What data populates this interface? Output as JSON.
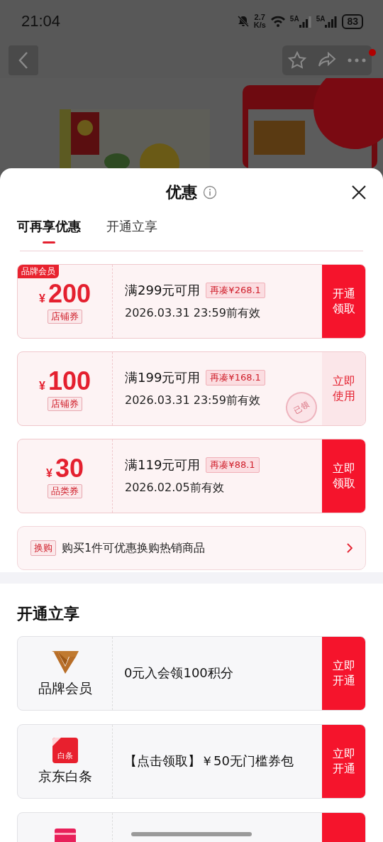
{
  "status_bar": {
    "time": "21:04",
    "net_speed": "2.7",
    "net_unit": "K/s",
    "sim1": "5A",
    "sim2": "5A",
    "battery": "83"
  },
  "sheet": {
    "title": "优惠",
    "tabs": [
      {
        "label": "可再享优惠",
        "selected": true
      },
      {
        "label": "开通立享",
        "selected": false
      }
    ]
  },
  "coupons": [
    {
      "kind": "claim",
      "badge": "品牌会员",
      "currency": "¥",
      "amount": "200",
      "type": "店铺券",
      "condition": "满299元可用",
      "gap": "再凑¥268.1",
      "validity": "2026.03.31 23:59前有效",
      "action": "开通领取"
    },
    {
      "kind": "use",
      "currency": "¥",
      "amount": "100",
      "type": "店铺券",
      "condition": "满199元可用",
      "gap": "再凑¥168.1",
      "validity": "2026.03.31 23:59前有效",
      "action": "立即使用",
      "stamp": "已领"
    },
    {
      "kind": "claim",
      "currency": "¥",
      "amount": "30",
      "type": "品类券",
      "condition": "满119元可用",
      "gap": "再凑¥88.1",
      "validity": "2026.02.05前有效",
      "action": "立即领取"
    }
  ],
  "swap": {
    "tag": "换购",
    "text": "购买1件可优惠换购热销商品"
  },
  "section_title": "开通立享",
  "services": [
    {
      "kind": "member",
      "label": "品牌会员",
      "text": "0元入会领100积分",
      "action": "立即开通"
    },
    {
      "kind": "baitiao",
      "icon_text": "白条",
      "label": "京东白条",
      "text": "【点击领取】￥50无门槛券包",
      "action": "立即开通"
    },
    {
      "kind": "card"
    }
  ]
}
